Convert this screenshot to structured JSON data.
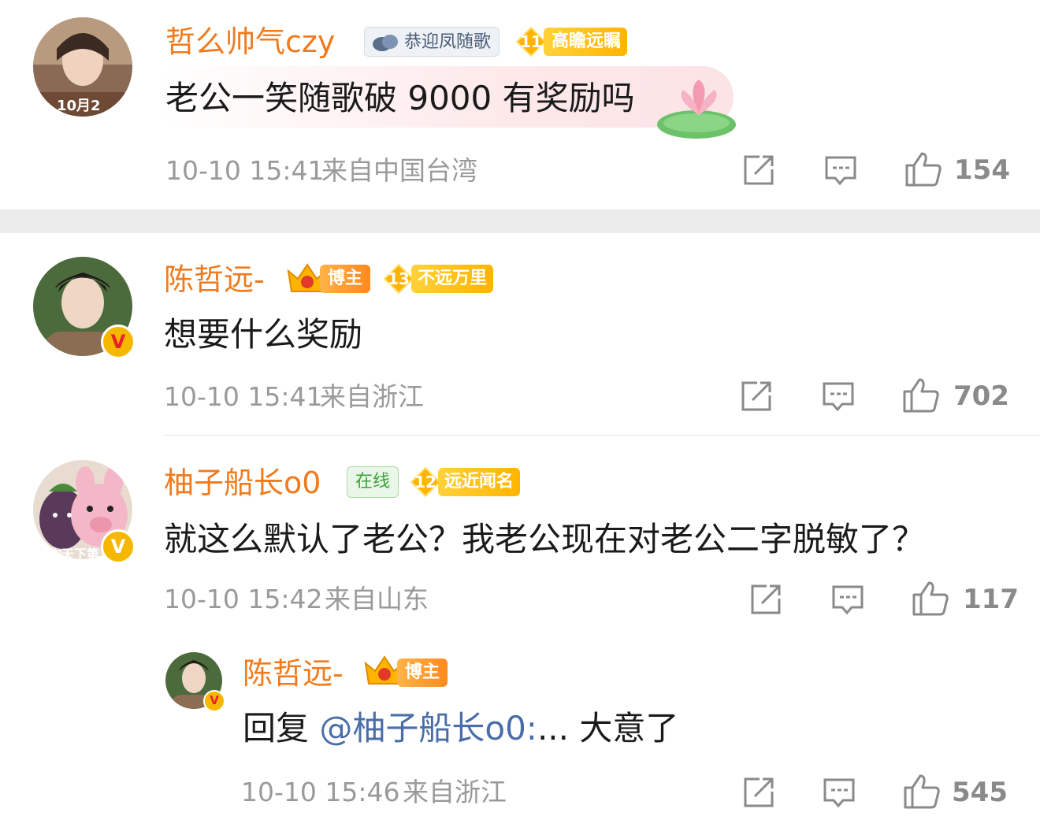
{
  "comments": [
    {
      "username": "哲么帅气czy",
      "badge1": "恭迎凤随歌",
      "level": "11",
      "level_title": "高瞻远瞩",
      "avatar_caption": "10月2",
      "text": "老公一笑随歌破 9000 有奖励吗",
      "time": "10-10 15:41",
      "location": "来自中国台湾",
      "likes": "154"
    },
    {
      "username": "陈哲远-",
      "badge1": "博主",
      "level": "13",
      "level_title": "不远万里",
      "verified": "V",
      "text": "想要什么奖励",
      "time": "10-10 15:41",
      "location": "来自浙江",
      "likes": "702"
    },
    {
      "username": "柚子船长o0",
      "badge1": "在线",
      "level": "12",
      "level_title": "远近闻名",
      "verified": "V",
      "avatar_caption": "你天下第",
      "text": "就这么默认了老公？我老公现在对老公二字脱敏了？",
      "time": "10-10 15:42",
      "location": "来自山东",
      "likes": "117"
    }
  ],
  "reply": {
    "username": "陈哲远-",
    "badge1": "博主",
    "verified": "V",
    "prefix": "回复",
    "mention": "@柚子船长o0:",
    "text": "... 大意了",
    "time": "10-10 15:46",
    "location": "来自浙江",
    "likes": "545"
  },
  "colors": {
    "username": "#f07b1e",
    "mention": "#4a6ea9",
    "meta": "#9a9a9a",
    "separator": "#ececec",
    "gold_badge": "#ffc21a"
  },
  "icons": {
    "share": "share-icon",
    "comment": "comment-icon",
    "like": "thumbs-up-icon"
  }
}
